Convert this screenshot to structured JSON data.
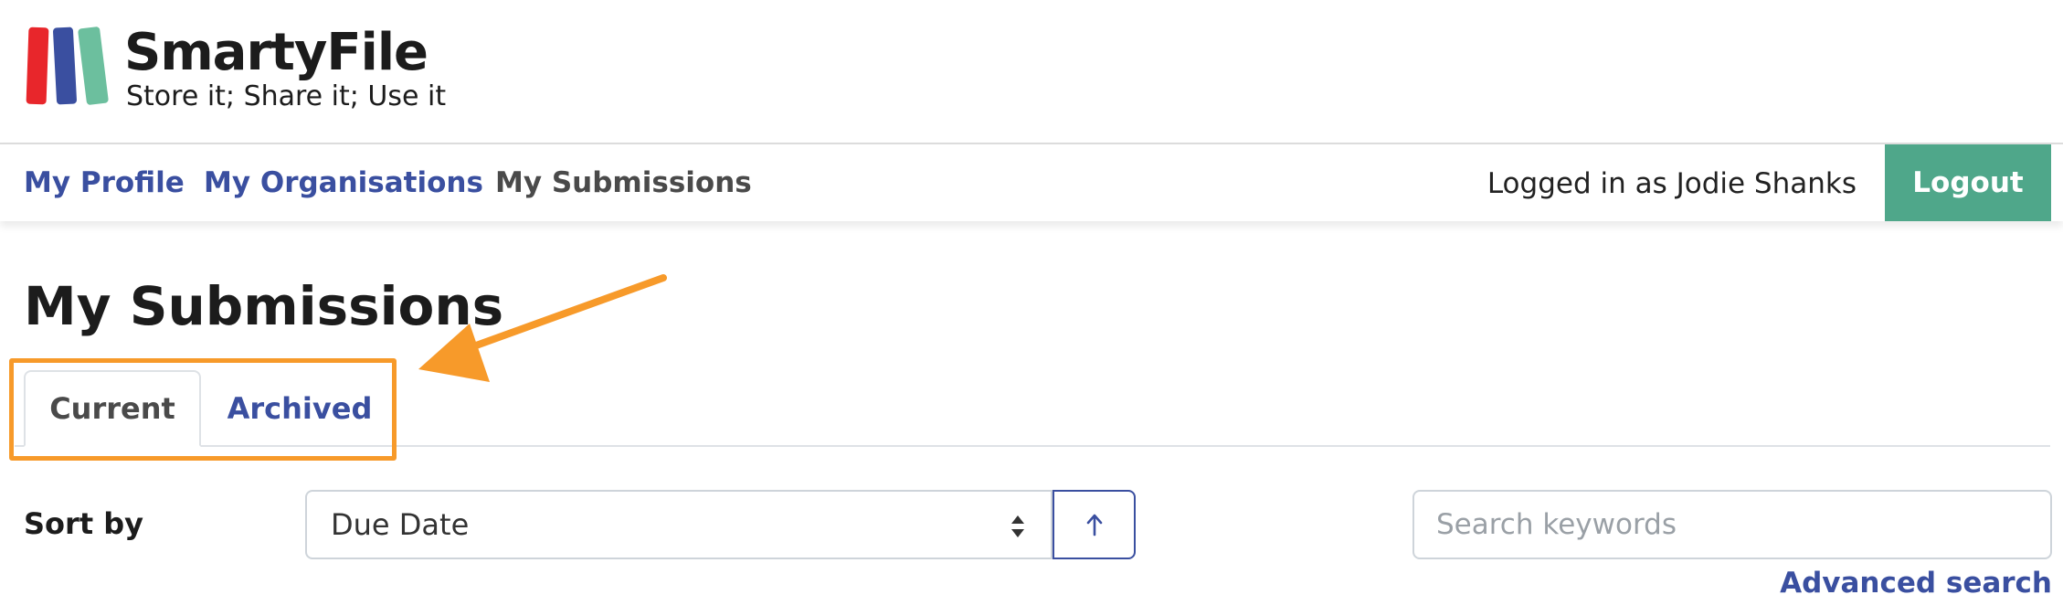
{
  "brand": {
    "name": "SmartyFile",
    "tagline": "Store it; Share it; Use it",
    "logo_colors": [
      "#e8262b",
      "#3a4fa0",
      "#6cbf9e"
    ]
  },
  "nav": {
    "links": [
      {
        "label": "My Profile"
      },
      {
        "label": "My Organisations"
      },
      {
        "label": "My Submissions"
      }
    ],
    "user_text": "Logged in as Jodie Shanks",
    "logout_label": "Logout"
  },
  "page": {
    "title": "My Submissions"
  },
  "tabs": [
    {
      "label": "Current",
      "active": true
    },
    {
      "label": "Archived",
      "active": false
    }
  ],
  "sort": {
    "label": "Sort by",
    "selected": "Due Date",
    "direction_icon": "arrow-up-icon"
  },
  "search": {
    "placeholder": "Search keywords",
    "value": "",
    "advanced_label": "Advanced search"
  },
  "colors": {
    "link": "#3a4fa0",
    "logout_bg": "#4fa78a",
    "annotation": "#f79a2a"
  }
}
